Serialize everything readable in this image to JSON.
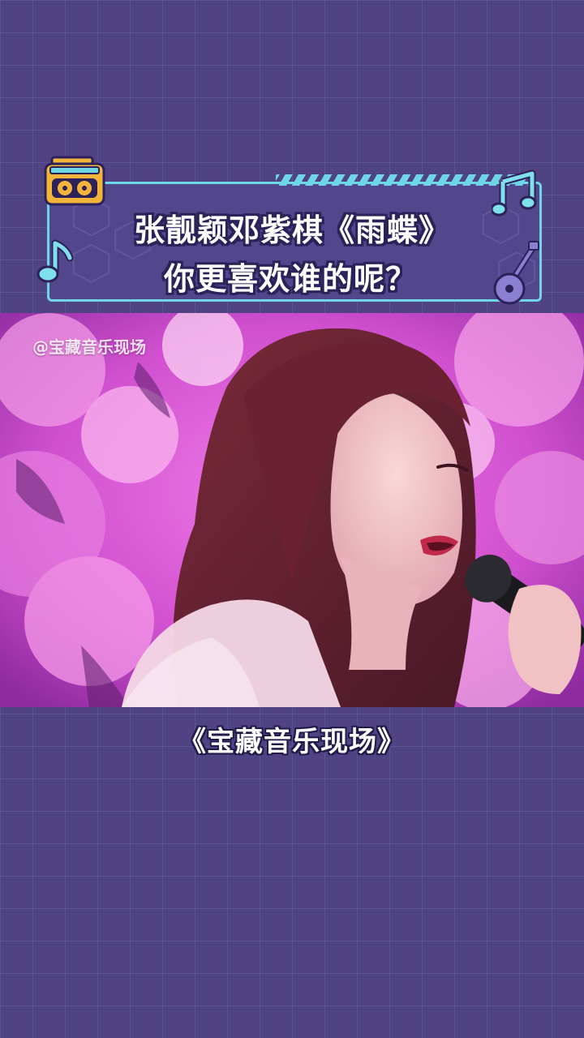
{
  "header": {
    "title_line_1": "张靓颖邓紫棋《雨蝶》",
    "title_line_2": "你更喜欢谁的呢？",
    "icons": [
      "radio-icon",
      "music-note-icon",
      "music-note-icon",
      "guitar-icon"
    ]
  },
  "video": {
    "watermark": "@宝藏音乐现场"
  },
  "caption": {
    "show_title": "《宝藏音乐现场》"
  },
  "colors": {
    "background": "#4f4383",
    "card_border": "#6fd6e8",
    "accent_yellow": "#f2b53a",
    "stage_pink": "#d352cf"
  }
}
